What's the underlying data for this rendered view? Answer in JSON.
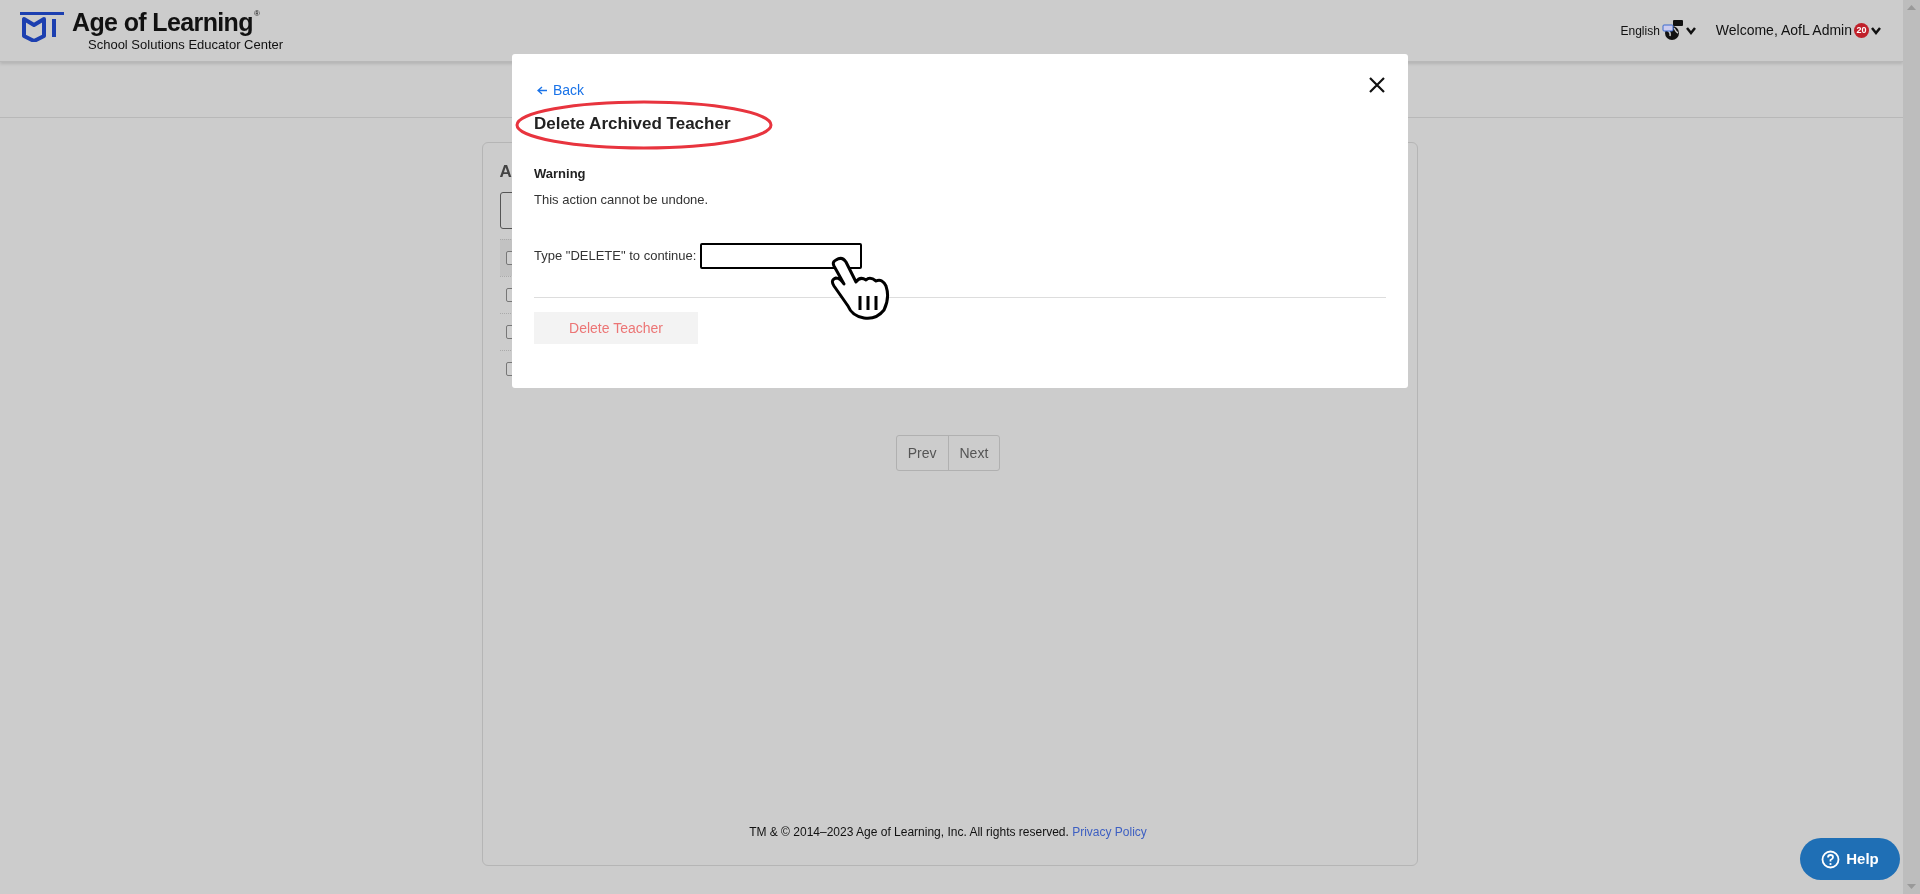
{
  "header": {
    "brand": "Age of Learning",
    "brand_mark": "®",
    "subtitle": "School Solutions Educator Center",
    "language": "English",
    "welcome": "Welcome, AofL Admin",
    "badge": "20"
  },
  "card": {
    "title": "A",
    "rows": [
      {
        "checked": false
      },
      {
        "checked": false
      },
      {
        "checked": false
      },
      {
        "checked": false
      }
    ]
  },
  "pagination": [
    {
      "label": "Prev"
    },
    {
      "label": "Next"
    }
  ],
  "footer": {
    "text": "TM & © 2014–2023 Age of Learning, Inc. All rights reserved.",
    "link": "Privacy Policy"
  },
  "help": {
    "label": "Help"
  },
  "modal": {
    "back": "Back",
    "title": "Delete Archived Teacher",
    "warning_title": "Warning",
    "warning_text": "This action cannot be undone.",
    "prompt": "Type \"DELETE\" to continue:",
    "button": {
      "label": "Delete Teacher",
      "disabled": true
    }
  }
}
